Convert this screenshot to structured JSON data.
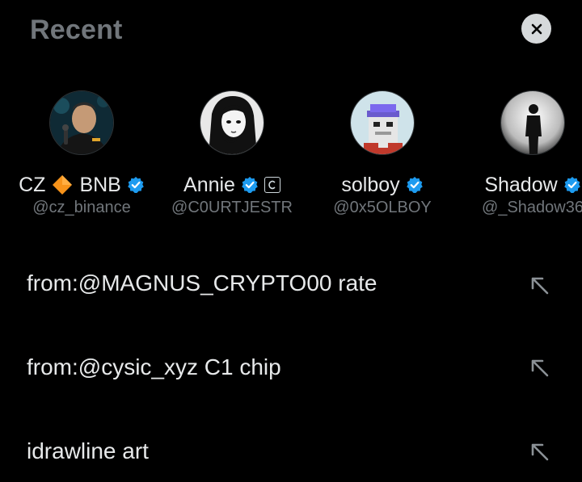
{
  "header": {
    "title": "Recent",
    "close_icon": "close-icon"
  },
  "accounts": [
    {
      "name_part1": "CZ",
      "name_part2": "BNB",
      "emoji": "orange-diamond",
      "handle": "@cz_binance",
      "verified": true
    },
    {
      "name": "Annie",
      "handle": "@C0URTJESTR",
      "verified": true,
      "affiliate_badge": true
    },
    {
      "name": "solboy",
      "handle": "@0x5OLBOY",
      "verified": true
    },
    {
      "name": "Shadow",
      "handle": "@_Shadow36",
      "verified": true
    }
  ],
  "searches": [
    {
      "text": "from:@MAGNUS_CRYPTO00 rate"
    },
    {
      "text": "from:@cysic_xyz C1 chip"
    },
    {
      "text": "idrawline art"
    }
  ],
  "colors": {
    "background": "#000000",
    "primary_text": "#e7e9ea",
    "secondary_text": "#71767b",
    "verified_blue": "#1d9bf0",
    "close_button_bg": "#d6d9db"
  }
}
